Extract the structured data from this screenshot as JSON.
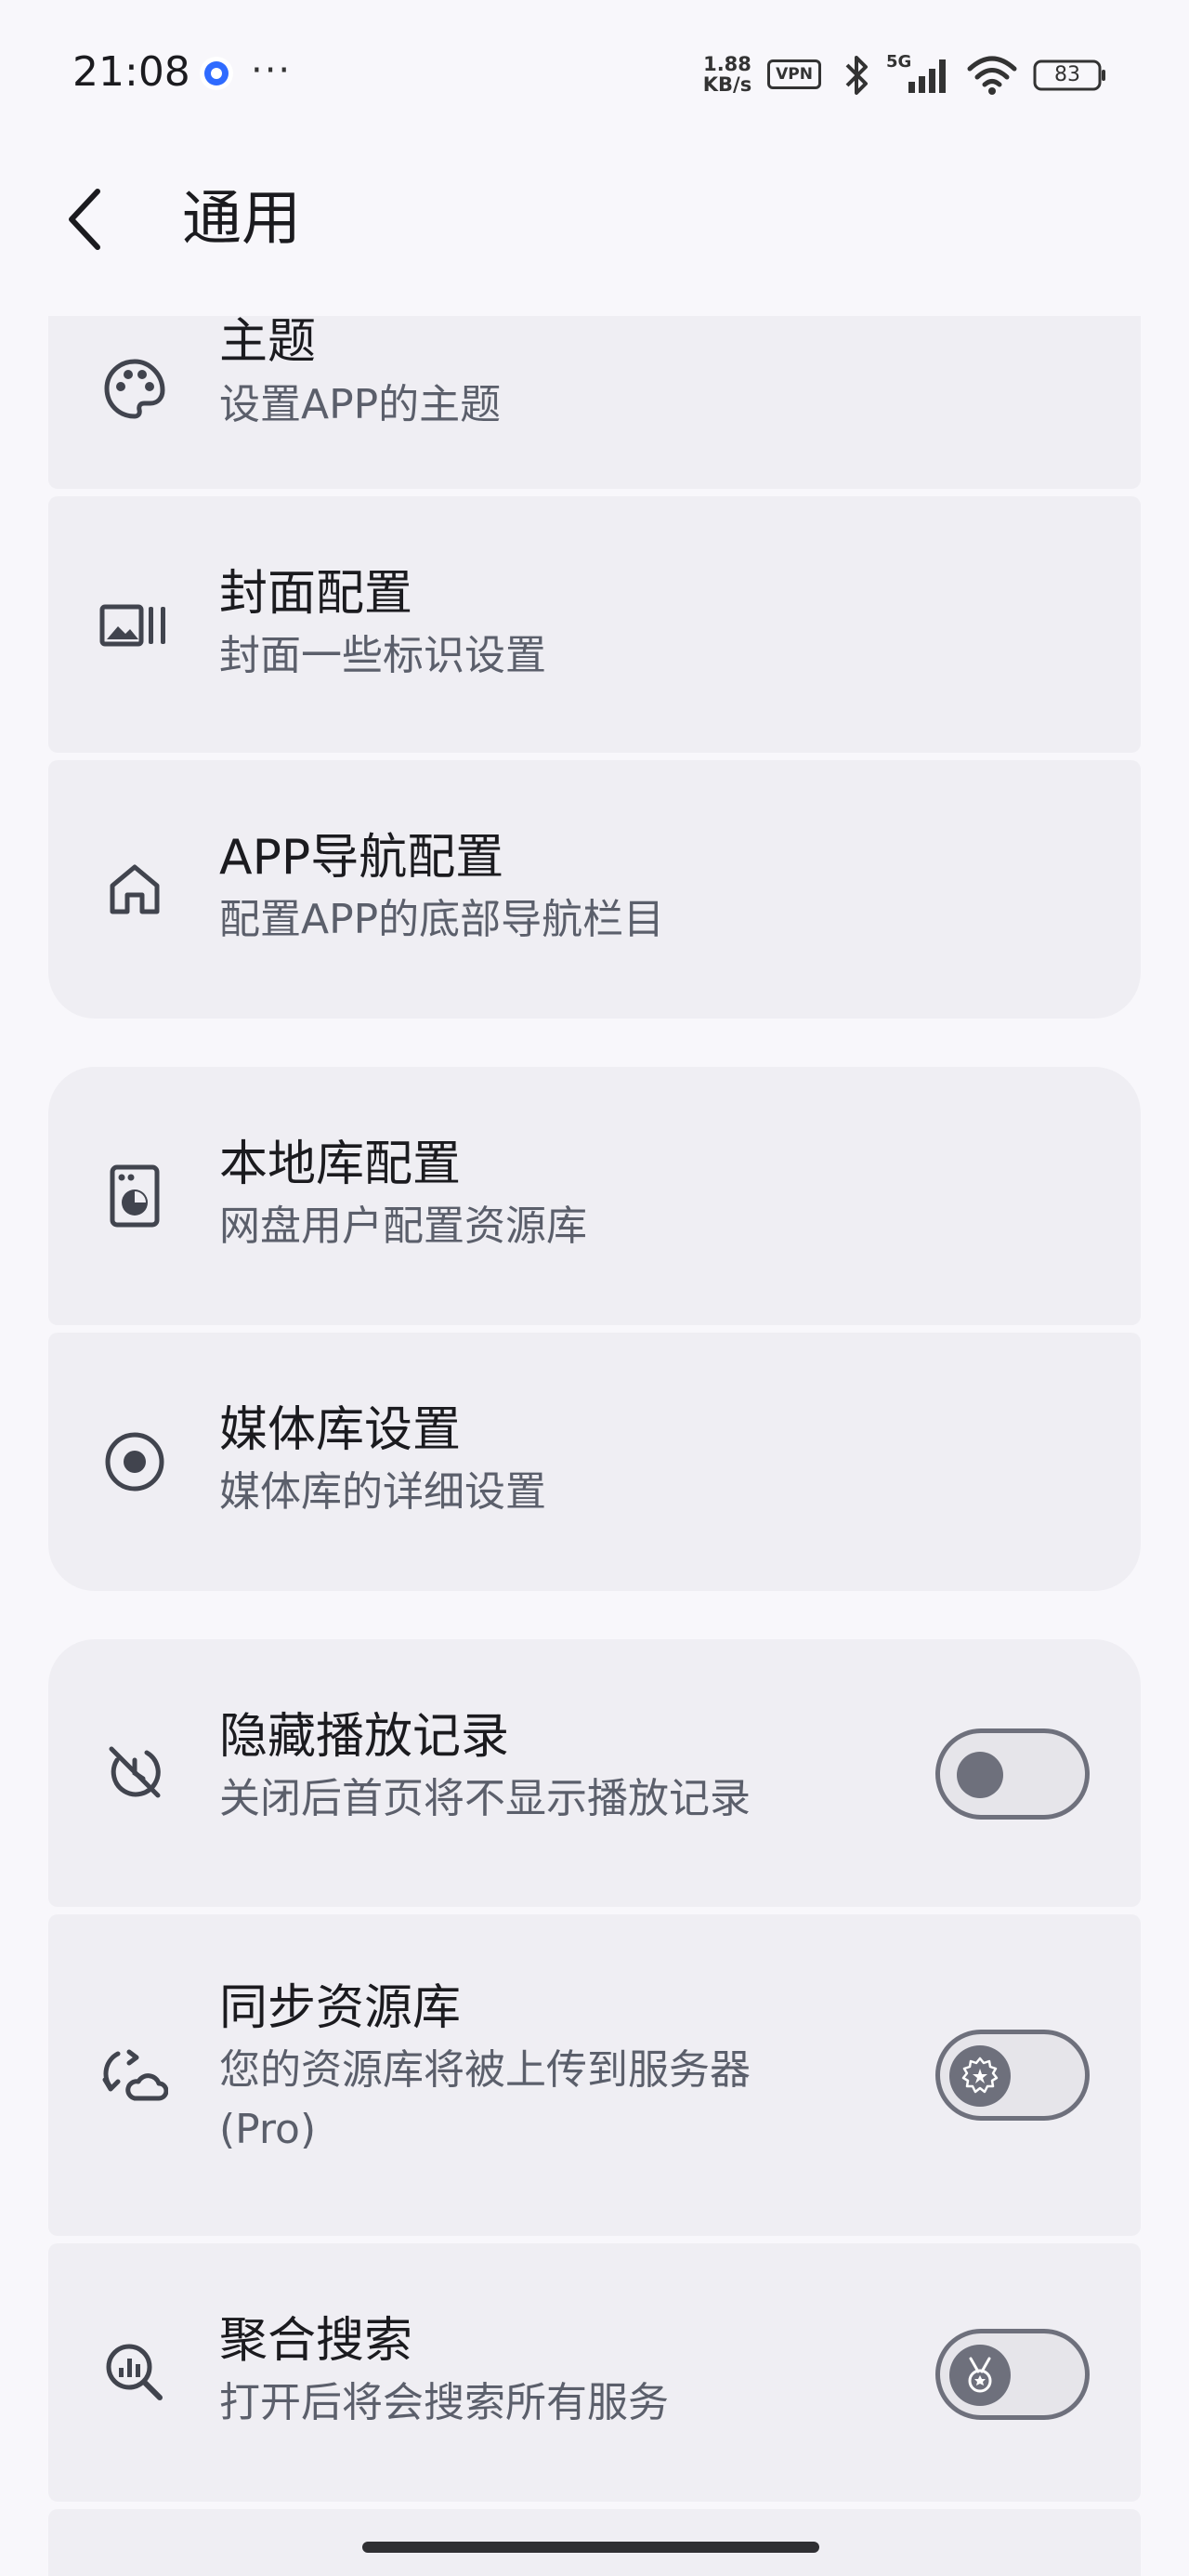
{
  "status_bar": {
    "time": "21:08",
    "dots": "···",
    "net_speed_value": "1.88",
    "net_speed_unit": "KB/s",
    "vpn": "VPN",
    "signal_label": "5G",
    "battery": "83"
  },
  "header": {
    "title": "通用"
  },
  "settings": [
    {
      "title": "主题",
      "subtitle": "设置APP的主题",
      "icon": "palette-icon"
    },
    {
      "title": "封面配置",
      "subtitle": "封面一些标识设置",
      "icon": "cover-image-icon"
    },
    {
      "title": "APP导航配置",
      "subtitle": "配置APP的底部导航栏目",
      "icon": "home-icon"
    },
    {
      "title": "本地库配置",
      "subtitle": "网盘用户配置资源库",
      "icon": "local-library-icon"
    },
    {
      "title": "媒体库设置",
      "subtitle": "媒体库的详细设置",
      "icon": "target-icon"
    },
    {
      "title": "隐藏播放记录",
      "subtitle": "关闭后首页将不显示播放记录",
      "icon": "hide-history-icon",
      "toggle": false
    },
    {
      "title": "同步资源库",
      "subtitle": "您的资源库将被上传到服务器(Pro)",
      "subtitle_line1": "您的资源库将被上传到服务器",
      "subtitle_line2": "(Pro)",
      "icon": "cloud-sync-icon",
      "toggle": false,
      "pro": true
    },
    {
      "title": "聚合搜索",
      "subtitle": "打开后将会搜索所有服务",
      "icon": "search-analytics-icon",
      "toggle": false,
      "pro": true
    }
  ]
}
